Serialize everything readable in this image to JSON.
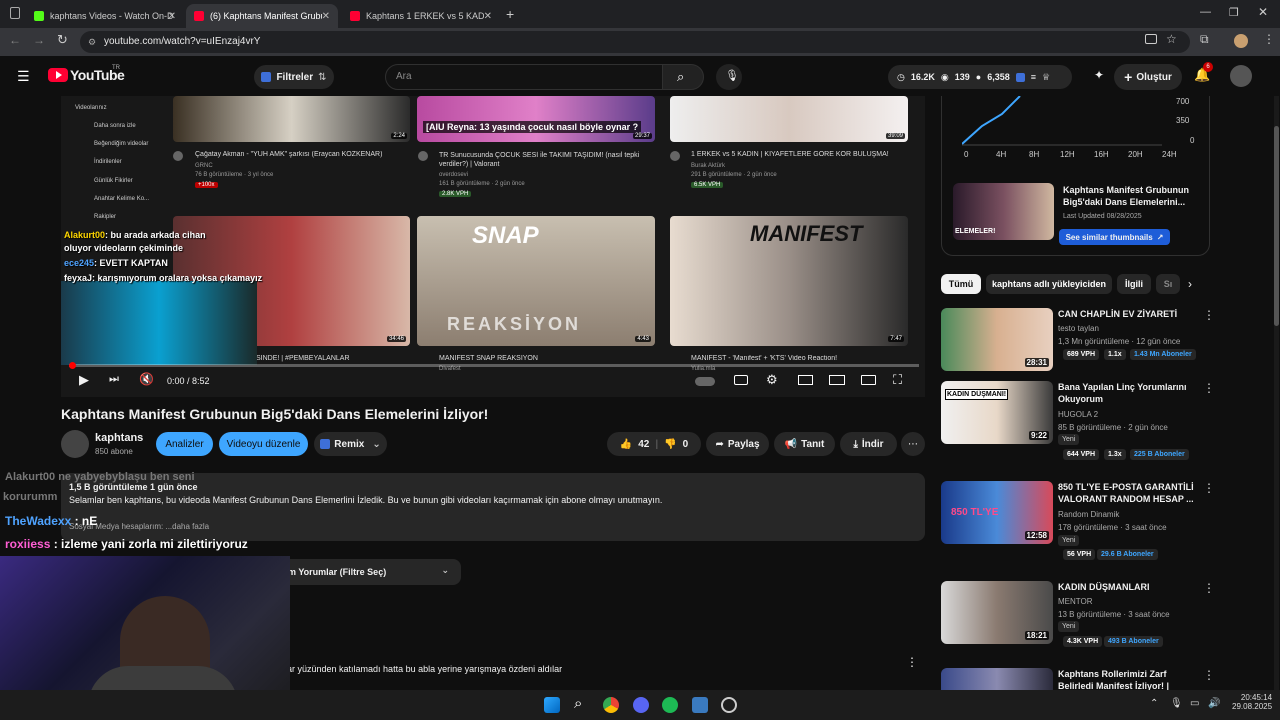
{
  "tabs": [
    {
      "label": "kaphtans Videos - Watch On-D",
      "color": "#53fc18"
    },
    {
      "label": "(6) Kaphtans Manifest Grubunu",
      "color": "#ff0033"
    },
    {
      "label": "Kaphtans 1 ERKEK vs 5 KADIN |",
      "color": "#ff0033"
    }
  ],
  "url": "youtube.com/watch?v=uIEnzaj4vrY",
  "header": {
    "logo": "YouTube",
    "region": "TR",
    "filter_label": "Filtreler",
    "search_placeholder": "Ara",
    "stats": [
      "16.2K",
      "139",
      "6,358"
    ],
    "create_label": "Oluştur",
    "notif_count": "6"
  },
  "player": {
    "sidebar_items": [
      "Videolarınız",
      "Daha sonra izle",
      "Beğendiğim videolar",
      "İndirilenler",
      "Günlük Fikirler",
      "Anahtar Kelime Ko...",
      "Rakipler"
    ],
    "videos_top": [
      {
        "title": "Çağatay Akman - \"YUH AMK\" şarkısı (Eraycan KÖZKENAR)",
        "channel": "GRNC",
        "meta": "76 B görüntüleme · 3 yıl önce",
        "dur": "2:24",
        "tag": "+100x"
      },
      {
        "title": "TR Sunucusunda ÇOCUK SESİ ile TAKIMI TAŞIDIM! (nasıl tepki verdiler?) | Valorant",
        "channel": "overdosevi",
        "meta": "161 B görüntüleme · 2 gün önce",
        "dur": "29:37",
        "overlay": "[AIU Reyna: 13 yaşında çocuk nasıl böyle oynar ?",
        "tag": "2.8K VPH"
      },
      {
        "title": "1 ERKEK vs 5 KADIN | KIYAFETLERE GÖRE KÖR BULUŞMA!",
        "channel": "Burak Aktürk",
        "meta": "291 B görüntüleme · 2 gün önce",
        "dur": "39:09",
        "tag": "6.5K VPH"
      }
    ],
    "videos_bottom": [
      {
        "title": "SİNDE! | #PEMBEYALANLAR",
        "dur": "34:46"
      },
      {
        "title": "MANİFEST SNAP REAKSİYON",
        "channel": "Divafest",
        "dur": "4:43",
        "overlay": "SNAP",
        "overlay2": "REAKSİYON"
      },
      {
        "title": "MANİFEST - 'Manifest' + 'KTS' Video Reaction!",
        "channel": "Yulia.mia",
        "dur": "7:47",
        "overlay": "MANIFEST"
      }
    ],
    "chat": [
      {
        "user": "Alakurt00",
        "text": ": bu arada arkada cihan",
        "color": "#ffd700"
      },
      {
        "user": "",
        "text": "oluyor videoların çekiminde",
        "color": "#fff"
      },
      {
        "user": "ece245",
        "text": ": EVETT KAPTAN",
        "color": "#4fa3ff"
      },
      {
        "user": "feyxaJ",
        "text": ": karışmıyorum oralara yoksa çıkamayız",
        "color": "#fff"
      }
    ],
    "time": "0:00 / 8:52"
  },
  "video": {
    "title": "Kaphtans Manifest Grubunun Big5'daki Dans Elemelerini İzliyor!",
    "channel": "kaphtans",
    "subs": "850 abone",
    "analyze_label": "Analizler",
    "edit_label": "Videoyu düzenle",
    "remix_label": "Remix",
    "likes": "42",
    "dislikes": "0",
    "share_label": "Paylaş",
    "promote_label": "Tanıt",
    "download_label": "İndir"
  },
  "description": {
    "stats": "1,5 B görüntüleme  1 gün önce",
    "text": "Selamlar ben kaphtans, bu videoda Manifest Grubunun Dans Elemerlini İzledik. Bu ve bunun gibi videoları kaçırmamak için abone olmayı unutmayın.",
    "more": "Sosyal Medya hesaplarım:   ...daha fazla"
  },
  "comments": {
    "sort_label": "Tüm Yorumlar (Filtre Seç)",
    "line": "ar yüzünden katılamadı hatta bu abla yerine yarışmaya özdeni aldılar"
  },
  "overlay_chat": [
    {
      "user": "Alakurt00",
      "text": "ne yabyebyblaşu ben seni",
      "color": "#888"
    },
    {
      "user": "korurumm",
      "text": "",
      "color": "#888"
    },
    {
      "user": "TheWadexx",
      "text": ": nE",
      "color": "#4fa3ff"
    },
    {
      "user": "roxiiess",
      "text": ": izleme yani zorla mi zilettiriyoruz",
      "color": "#ff5ed4"
    }
  ],
  "analytics": {
    "y_ticks": [
      "700",
      "350",
      "0"
    ],
    "x_ticks": [
      "0",
      "4H",
      "8H",
      "12H",
      "16H",
      "20H",
      "24H"
    ],
    "card_title": "Kaphtans Manifest Grubunun Big5'daki Dans Elemelerini...",
    "card_updated": "Last Updated 08/28/2025",
    "card_button": "See similar thumbnails",
    "thumb_text": "ELEMELER!"
  },
  "chips": [
    "Tümü",
    "kaphtans adlı yükleyiciden",
    "İlgili",
    "Sı"
  ],
  "sidebar_videos": [
    {
      "title": "CAN CHAPLİN EV ZİYARETİ",
      "channel": "testo taylan",
      "meta": "1,3 Mn görüntüleme · 12 gün önce",
      "dur": "28:31",
      "vph": "689 VPH",
      "mult": "1.1x",
      "subs": "1.43 Mn Aboneler",
      "new": ""
    },
    {
      "title": "Bana Yapılan Linç Yorumlarını Okuyorum",
      "channel": "HUGOLA 2",
      "meta": "85 B görüntüleme · 2 gün önce",
      "dur": "9:22",
      "vph": "644 VPH",
      "mult": "1.3x",
      "subs": "225 B Aboneler",
      "new": "Yeni",
      "overlay": "KADIN DÜŞMANI!"
    },
    {
      "title": "850 TL'YE E-POSTA GARANTİLİ VALORANT RANDOM HESAP ...",
      "channel": "Random Dinamik",
      "meta": "178 görüntüleme · 3 saat önce",
      "dur": "12:58",
      "vph": "56 VPH",
      "mult": "",
      "subs": "29.6 B Aboneler",
      "new": "Yeni",
      "overlay": "850 TL'YE"
    },
    {
      "title": "KADIN DÜŞMANLARI",
      "channel": "MENTOR",
      "meta": "13 B görüntüleme · 3 saat önce",
      "dur": "18:21",
      "vph": "4.3K VPH",
      "mult": "",
      "subs": "493 B Aboneler",
      "new": "Yeni"
    },
    {
      "title": "Kaphtans Rollerimizi Zarf Belirledi Manifest İzliyor! |",
      "channel": "",
      "meta": "",
      "dur": "",
      "vph": "",
      "mult": "",
      "subs": "",
      "new": ""
    }
  ],
  "taskbar": {
    "time": "20:45:14",
    "date": "29.08.2025"
  }
}
